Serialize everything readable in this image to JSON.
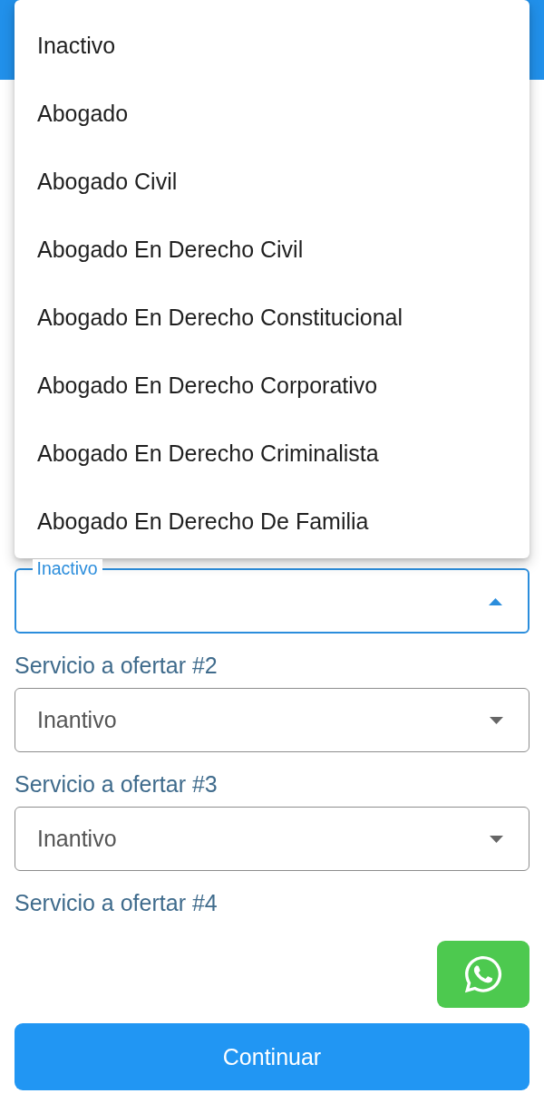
{
  "dropdown_menu": {
    "options": [
      "Inactivo",
      "Abogado",
      "Abogado Civil",
      "Abogado En Derecho Civil",
      "Abogado En Derecho Constitucional",
      "Abogado En Derecho Corporativo",
      "Abogado En Derecho Criminalista",
      "Abogado En Derecho De Familia"
    ]
  },
  "form": {
    "fields": [
      {
        "select": {
          "floating_label": "Inactivo",
          "open": true
        }
      },
      {
        "label": "Servicio a ofertar #2",
        "select": {
          "value": "Inantivo",
          "open": false
        }
      },
      {
        "label": "Servicio a ofertar #3",
        "select": {
          "value": "Inantivo",
          "open": false
        }
      },
      {
        "label": "Servicio a ofertar #4"
      }
    ]
  },
  "continue_button": {
    "label": "Continuar"
  }
}
